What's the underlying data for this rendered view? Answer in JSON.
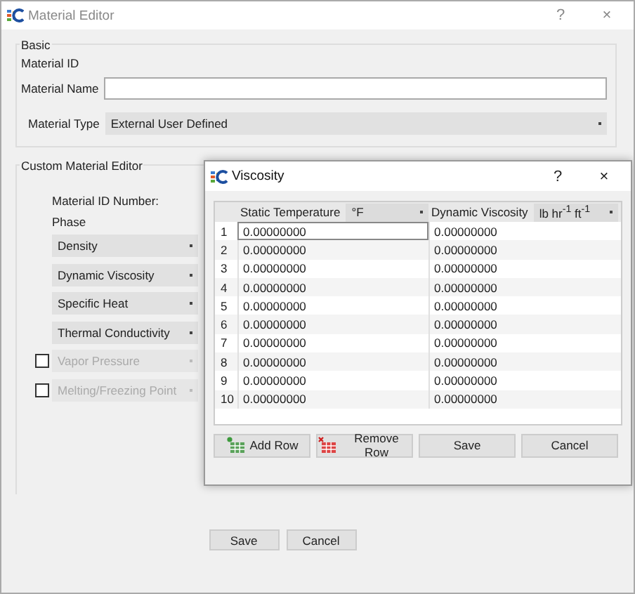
{
  "window": {
    "title": "Material Editor",
    "help": "?",
    "close": "×"
  },
  "basic": {
    "title": "Basic",
    "material_id_label": "Material ID",
    "material_name_label": "Material Name",
    "material_type_label": "Material Type",
    "material_type_value": "External User Defined"
  },
  "custom": {
    "title": "Custom Material Editor",
    "id_number_label": "Material ID Number:",
    "phase_label": "Phase",
    "properties": [
      {
        "kind": "combo",
        "label": "Density",
        "disabled": false
      },
      {
        "kind": "combo",
        "label": "Dynamic Viscosity",
        "disabled": false
      },
      {
        "kind": "combo",
        "label": "Specific Heat",
        "disabled": false
      },
      {
        "kind": "combo",
        "label": "Thermal Conductivity",
        "disabled": false
      },
      {
        "kind": "check-combo",
        "label": "Vapor Pressure",
        "disabled": true,
        "checked": false
      },
      {
        "kind": "check-combo",
        "label": "Melting/Freezing Point",
        "disabled": true,
        "checked": false
      }
    ]
  },
  "dialog": {
    "title": "Viscosity",
    "help": "?",
    "close": "×",
    "columns": [
      {
        "label": "Static Temperature",
        "unit": "°F"
      },
      {
        "label": "Dynamic Viscosity",
        "unit": "lb hr$^{-1}$ ft$^{-1}$"
      }
    ],
    "rows": [
      {
        "number": "1",
        "values": [
          "0.00000000",
          "0.00000000"
        ],
        "editing": true
      },
      {
        "number": "2",
        "values": [
          "0.00000000",
          "0.00000000"
        ],
        "editing": false
      },
      {
        "number": "3",
        "values": [
          "0.00000000",
          "0.00000000"
        ],
        "editing": false
      },
      {
        "number": "4",
        "values": [
          "0.00000000",
          "0.00000000"
        ],
        "editing": false
      },
      {
        "number": "5",
        "values": [
          "0.00000000",
          "0.00000000"
        ],
        "editing": false
      },
      {
        "number": "6",
        "values": [
          "0.00000000",
          "0.00000000"
        ],
        "editing": false
      },
      {
        "number": "7",
        "values": [
          "0.00000000",
          "0.00000000"
        ],
        "editing": false
      },
      {
        "number": "8",
        "values": [
          "0.00000000",
          "0.00000000"
        ],
        "editing": false
      },
      {
        "number": "9",
        "values": [
          "0.00000000",
          "0.00000000"
        ],
        "editing": false
      },
      {
        "number": "10",
        "values": [
          "0.00000000",
          "0.00000000"
        ],
        "editing": false
      }
    ],
    "buttons": [
      {
        "kind": "add",
        "label": "Add Row"
      },
      {
        "kind": "remove",
        "label": "Remove Row"
      },
      {
        "kind": "plain",
        "label": "Save"
      },
      {
        "kind": "plain",
        "label": "Cancel"
      }
    ]
  },
  "buttons": [
    "Save",
    "Cancel"
  ]
}
